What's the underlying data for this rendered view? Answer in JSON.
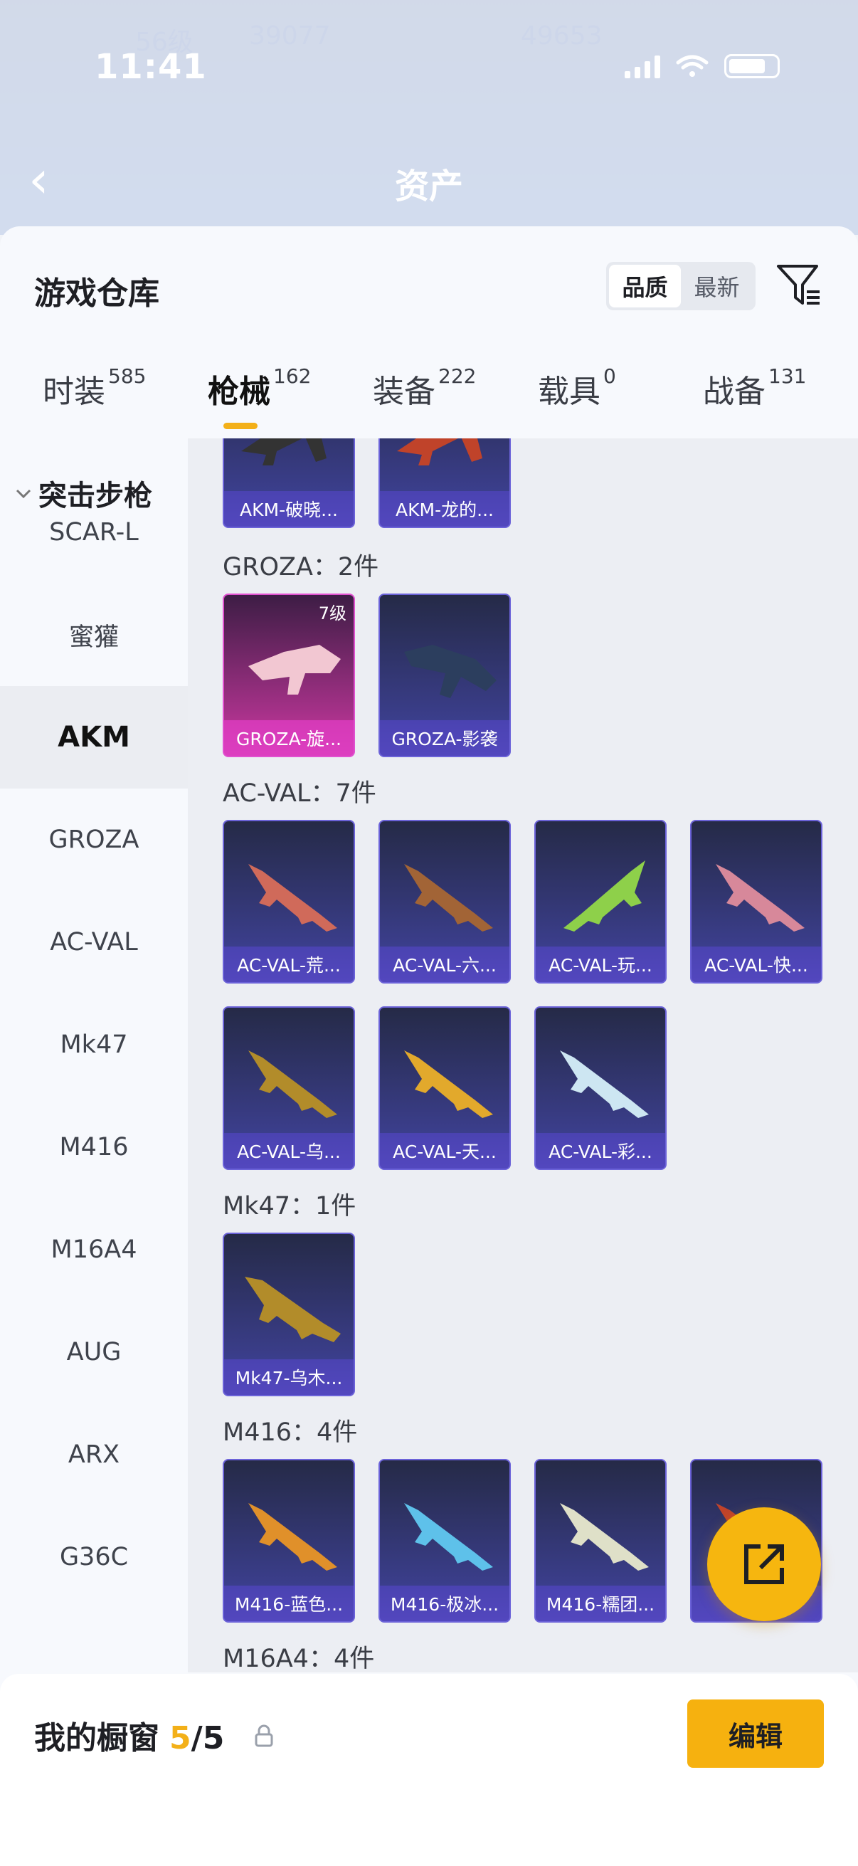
{
  "status": {
    "time": "11:41"
  },
  "background": {
    "title": "资产",
    "faint_texts": [
      "56级",
      "39077",
      "49653"
    ]
  },
  "sheet": {
    "title": "游戏仓库",
    "sort": [
      "品质",
      "最新"
    ],
    "sort_active": 0,
    "tabs": [
      {
        "label": "时装",
        "count": "585"
      },
      {
        "label": "枪械",
        "count": "162"
      },
      {
        "label": "装备",
        "count": "222"
      },
      {
        "label": "载具",
        "count": "0"
      },
      {
        "label": "战备",
        "count": "131"
      }
    ],
    "active_tab": 1
  },
  "sidebar": {
    "category": "突击步枪",
    "items": [
      "SCAR-L",
      "蜜獾",
      "AKM",
      "GROZA",
      "AC-VAL",
      "Mk47",
      "M416",
      "M16A4",
      "AUG",
      "ARX",
      "G36C"
    ],
    "active_index": 2
  },
  "groups": [
    {
      "title": "",
      "items": [
        {
          "label": "AKM-破晓..."
        },
        {
          "label": "AKM-龙的..."
        }
      ]
    },
    {
      "title": "GROZA：2件",
      "items": [
        {
          "label": "GROZA-旋...",
          "level": "7级",
          "rarity": "pink"
        },
        {
          "label": "GROZA-影袭"
        }
      ]
    },
    {
      "title": "AC-VAL：7件",
      "items": [
        {
          "label": "AC-VAL-荒..."
        },
        {
          "label": "AC-VAL-六..."
        },
        {
          "label": "AC-VAL-玩..."
        },
        {
          "label": "AC-VAL-快..."
        },
        {
          "label": "AC-VAL-乌..."
        },
        {
          "label": "AC-VAL-天..."
        },
        {
          "label": "AC-VAL-彩..."
        }
      ]
    },
    {
      "title": "Mk47：1件",
      "items": [
        {
          "label": "Mk47-乌木..."
        }
      ]
    },
    {
      "title": "M416：4件",
      "items": [
        {
          "label": "M416-蓝色..."
        },
        {
          "label": "M416-极冰..."
        },
        {
          "label": "M416-糯团..."
        },
        {
          "label": "M..."
        }
      ]
    },
    {
      "title": "M16A4：4件",
      "items": []
    }
  ],
  "bottom": {
    "label": "我的橱窗",
    "count": "5",
    "slash": "/5",
    "edit": "编辑"
  },
  "colors": {
    "accent": "#f3b019",
    "card_purple": "#3b3e8c",
    "card_pink": "#b0338f"
  }
}
